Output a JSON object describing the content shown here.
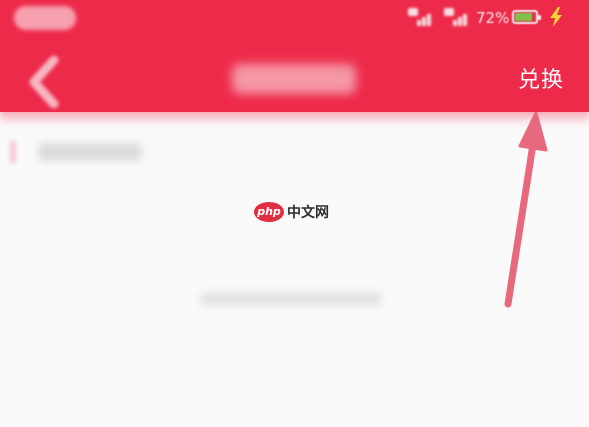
{
  "status_bar": {
    "time": "",
    "battery_percent": "72%",
    "signal_icons": [
      "signal-hd-icon",
      "wifi-signal-icon"
    ],
    "battery_icon": "battery-charging-icon"
  },
  "header": {
    "back_icon": "chevron-left-icon",
    "title": "",
    "action_label": "兑换",
    "background_color": "#ee2a4b"
  },
  "content": {
    "section_label": "",
    "empty_message": ""
  },
  "watermark": {
    "badge": "php",
    "text": "中文网"
  },
  "annotation": {
    "arrow_icon": "pointer-arrow-icon",
    "arrow_color": "#e8697e"
  }
}
